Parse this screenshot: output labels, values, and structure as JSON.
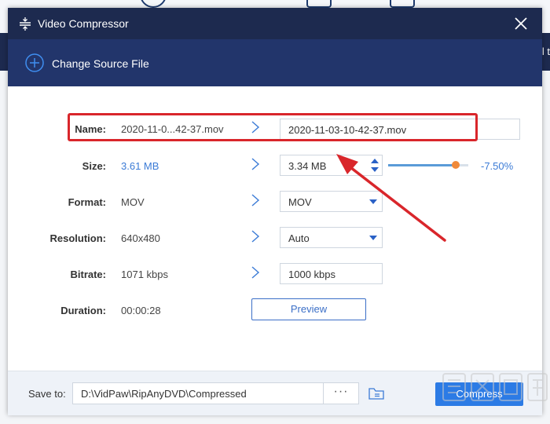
{
  "window": {
    "title": "Video Compressor"
  },
  "source": {
    "change_label": "Change Source File"
  },
  "background": {
    "partial_text": "l t"
  },
  "rows": {
    "name": {
      "label": "Name:",
      "original": "2020-11-0...42-37.mov",
      "output": "2020-11-03-10-42-37.mov"
    },
    "size": {
      "label": "Size:",
      "original": "3.61 MB",
      "output": "3.34 MB",
      "slider_fraction": 0.84,
      "percent": "-7.50%"
    },
    "format": {
      "label": "Format:",
      "original": "MOV",
      "output": "MOV"
    },
    "resolution": {
      "label": "Resolution:",
      "original": "640x480",
      "output": "Auto"
    },
    "bitrate": {
      "label": "Bitrate:",
      "original": "1071 kbps",
      "output": "1000 kbps"
    },
    "duration": {
      "label": "Duration:",
      "original": "00:00:28"
    }
  },
  "preview": {
    "label": "Preview"
  },
  "footer": {
    "save_to_label": "Save to:",
    "path": "D:\\VidPaw\\RipAnyDVD\\Compressed",
    "browse_label": "···",
    "compress_label": "Compress"
  },
  "colors": {
    "titlebar": "#1d2a4f",
    "source_bar": "#22356b",
    "accent": "#2c7be5",
    "annotation": "#d9262b",
    "slider_thumb": "#f08a3a"
  }
}
